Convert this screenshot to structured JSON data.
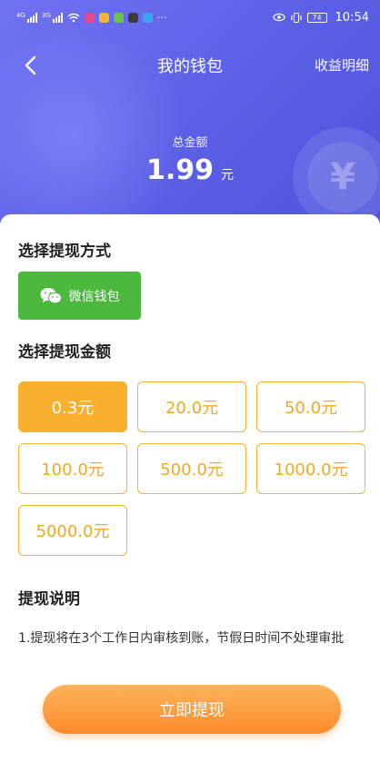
{
  "status_bar": {
    "sig1_label": "4G",
    "sig2_label": "3G",
    "overflow": "···",
    "battery": "74",
    "time": "10:54"
  },
  "nav": {
    "title": "我的钱包",
    "right_link": "收益明细"
  },
  "wallet": {
    "total_label": "总金额",
    "total_amount": "1.99",
    "total_unit": "元",
    "coin_symbol": "¥"
  },
  "withdraw_method": {
    "title": "选择提现方式",
    "wechat_label": "微信钱包"
  },
  "withdraw_amount": {
    "title": "选择提现金额",
    "options": [
      "0.3元",
      "20.0元",
      "50.0元",
      "100.0元",
      "500.0元",
      "1000.0元",
      "5000.0元"
    ],
    "selected_index": 0
  },
  "instructions": {
    "title": "提现说明",
    "text": "1.提现将在3个工作日内审核到账，节假日时间不处理审批"
  },
  "submit_label": "立即提现",
  "colors": {
    "header": "#5b5fe6",
    "accent": "#f8b02e",
    "wechat": "#4cb93e",
    "button": "#fb8a2b"
  }
}
